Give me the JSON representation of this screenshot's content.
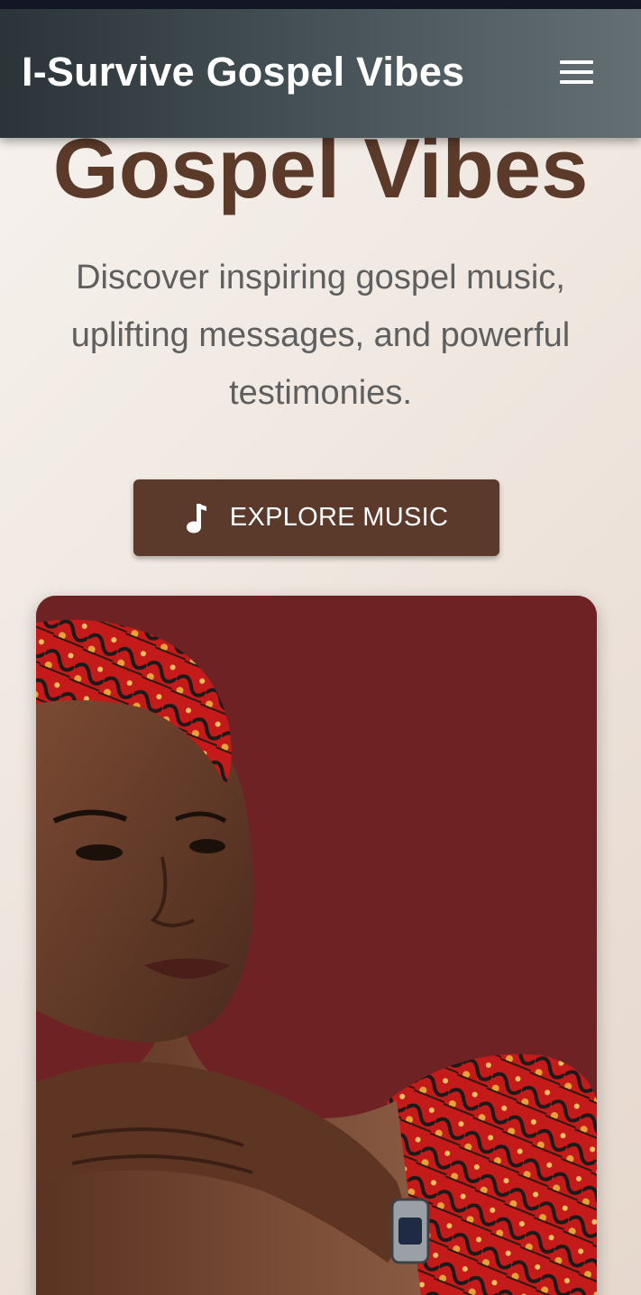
{
  "header": {
    "title": "I-Survive Gospel Vibes",
    "menu_icon": "hamburger-menu-icon"
  },
  "hero": {
    "heading": "Gospel Vibes",
    "description": "Discover inspiring gospel music, uplifting messages, and powerful testimonies.",
    "cta_label": "EXPLORE MUSIC",
    "cta_icon": "music-note-icon",
    "image_subject": "woman-portrait"
  },
  "colors": {
    "app_bar_start": "#2b3438",
    "app_bar_end": "#646f73",
    "heading": "#5b3a29",
    "button_bg": "#5b3a2b",
    "image_backdrop": "#6f2224"
  }
}
